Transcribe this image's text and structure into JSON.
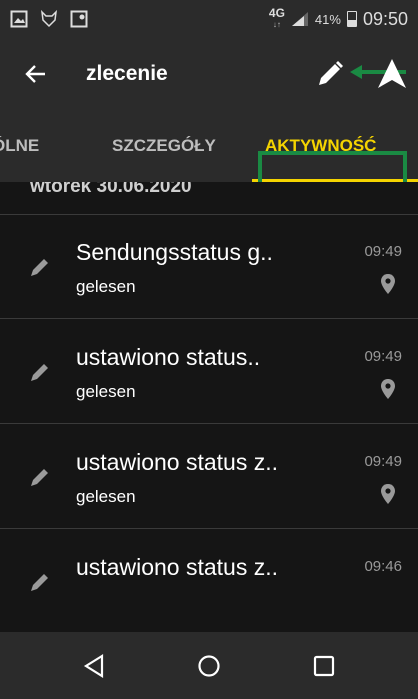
{
  "status_bar": {
    "network": "4G",
    "network_sub": "↓↑",
    "battery": "41%",
    "time": "09:50"
  },
  "app_bar": {
    "title": "zlecenie",
    "icons": [
      "back-arrow-icon",
      "pencil-icon",
      "navigation-icon"
    ]
  },
  "tabs": [
    {
      "label": "ÓLNE",
      "active": false
    },
    {
      "label": "SZCZEGÓŁY",
      "active": false
    },
    {
      "label": "AKTYWNOŚĆ",
      "active": true
    }
  ],
  "colors": {
    "accent": "#f5d400",
    "highlight_box": "#1a8a43",
    "bar_bg": "#2b2b2b",
    "content_bg": "#151515"
  },
  "activity": {
    "date": "wtorek 30.06.2020",
    "items": [
      {
        "title": "Sendungsstatus g..",
        "subtitle": "gelesen",
        "time": "09:49",
        "icon": "pencil-icon"
      },
      {
        "title": "ustawiono status..",
        "subtitle": "gelesen",
        "time": "09:49",
        "icon": "pencil-icon"
      },
      {
        "title": "ustawiono status z..",
        "subtitle": "gelesen",
        "time": "09:49",
        "icon": "pencil-icon"
      },
      {
        "title": "ustawiono status z..",
        "subtitle": "",
        "time": "09:46",
        "icon": "pencil-icon"
      }
    ]
  }
}
